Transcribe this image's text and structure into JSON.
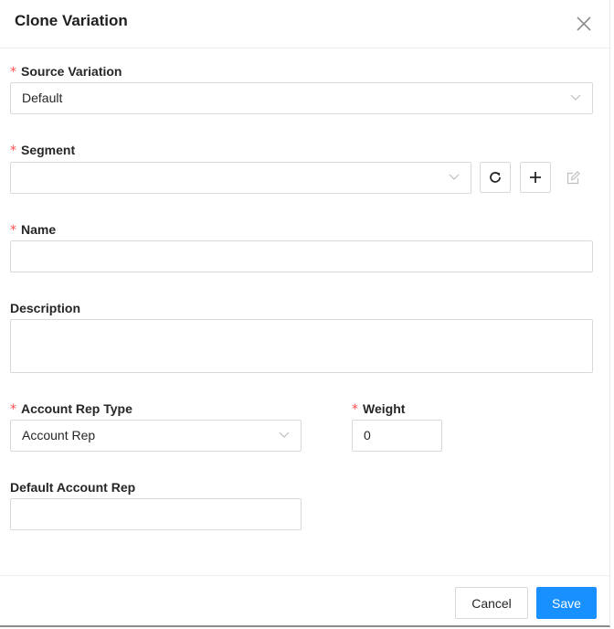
{
  "modal": {
    "title": "Clone Variation"
  },
  "required_mark": "*",
  "fields": {
    "source_variation": {
      "label": "Source Variation",
      "value": "Default"
    },
    "segment": {
      "label": "Segment",
      "value": ""
    },
    "name": {
      "label": "Name",
      "value": ""
    },
    "description": {
      "label": "Description",
      "value": ""
    },
    "account_rep_type": {
      "label": "Account Rep Type",
      "value": "Account Rep"
    },
    "weight": {
      "label": "Weight",
      "value": "0"
    },
    "default_account_rep": {
      "label": "Default Account Rep",
      "value": ""
    }
  },
  "footer": {
    "cancel_label": "Cancel",
    "save_label": "Save"
  },
  "colors": {
    "primary": "#1890ff",
    "required": "#ff4d4f",
    "border": "#d9d9d9"
  }
}
